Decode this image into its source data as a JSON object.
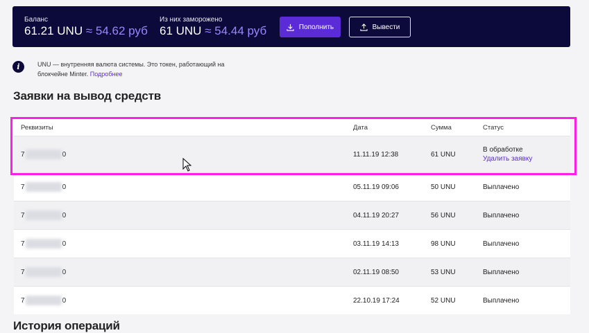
{
  "balance": {
    "label": "Баланс",
    "amount": "61.21 UNU",
    "approx": " ≈ 54.62 руб"
  },
  "frozen": {
    "label": "Из них заморожено",
    "amount": "61 UNU",
    "approx": " ≈ 54.44 руб"
  },
  "buttons": {
    "topup": "Пополнить",
    "withdraw": "Вывести"
  },
  "info": {
    "icon": "info-icon",
    "text": "UNU — внутренняя валюта системы. Это токен, работающий на блокчейне Minter.",
    "link": "Подробнее"
  },
  "withdrawals": {
    "title": "Заявки на вывод средств",
    "columns": {
      "requisites": "Реквизиты",
      "date": "Дата",
      "sum": "Сумма",
      "status": "Статус"
    },
    "rows": [
      {
        "req_start": "7",
        "req_end": "0",
        "date": "11.11.19 12:38",
        "sum": "61 UNU",
        "status": "В обработке",
        "action": "Удалить заявку"
      },
      {
        "req_start": "7",
        "req_end": "0",
        "date": "05.11.19 09:06",
        "sum": "50 UNU",
        "status": "Выплачено"
      },
      {
        "req_start": "7",
        "req_end": "0",
        "date": "04.11.19 20:27",
        "sum": "56 UNU",
        "status": "Выплачено"
      },
      {
        "req_start": "7",
        "req_end": "0",
        "date": "03.11.19 14:13",
        "sum": "98 UNU",
        "status": "Выплачено"
      },
      {
        "req_start": "7",
        "req_end": "0",
        "date": "02.11.19 08:50",
        "sum": "53 UNU",
        "status": "Выплачено"
      },
      {
        "req_start": "7",
        "req_end": "0",
        "date": "22.10.19 17:24",
        "sum": "52 UNU",
        "status": "Выплачено"
      }
    ]
  },
  "history": {
    "title": "История операций"
  },
  "colors": {
    "header_bg": "#0c0a3a",
    "accent": "#5b2bd8",
    "highlight": "#ff1ee8"
  }
}
